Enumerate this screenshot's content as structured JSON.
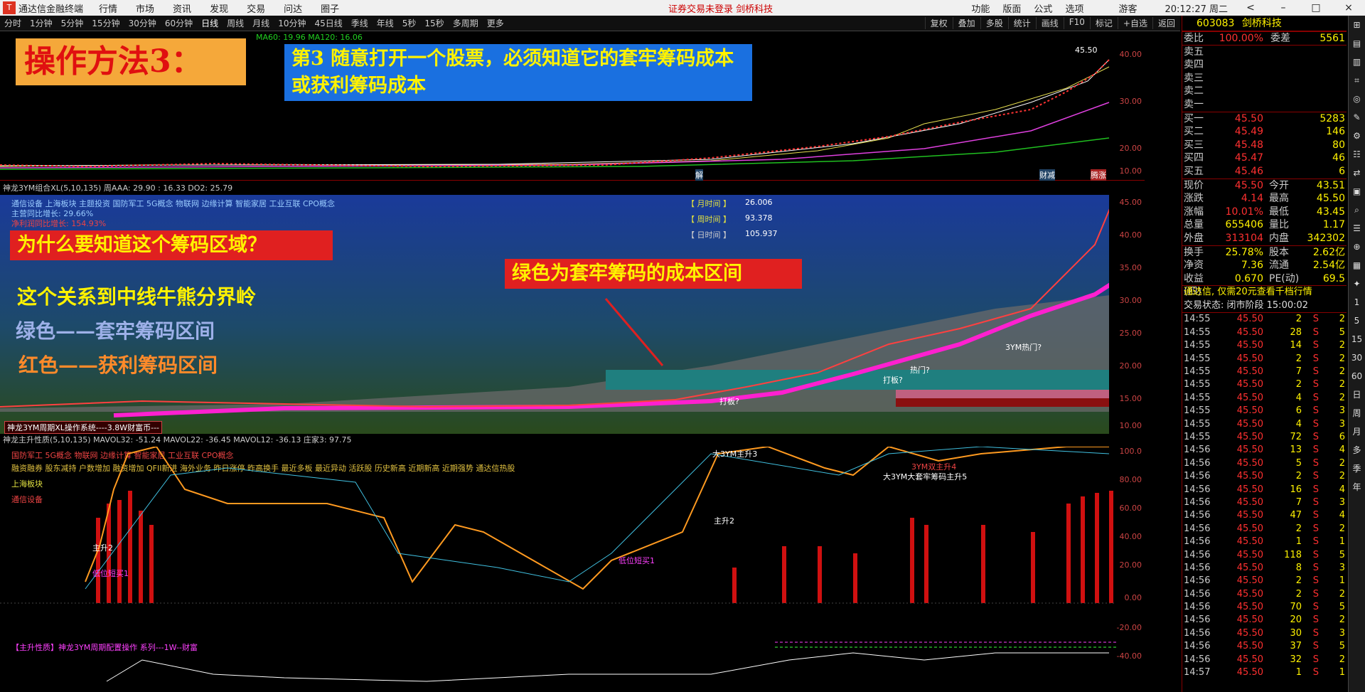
{
  "menubar": {
    "app_title": "通达信金融终端",
    "menus": [
      "行情",
      "市场",
      "资讯",
      "发现",
      "交易",
      "问达",
      "圈子"
    ],
    "center_notice": "证券交易未登录  剑桥科技",
    "right_items": [
      "功能",
      "版面",
      "公式",
      "选项"
    ],
    "user": "游客",
    "clock": "20:12:27 周二"
  },
  "periodbar": {
    "periods": [
      "分时",
      "1分钟",
      "5分钟",
      "15分钟",
      "30分钟",
      "60分钟",
      "日线",
      "周线",
      "月线",
      "10分钟",
      "45日线",
      "季线",
      "年线",
      "5秒",
      "15秒",
      "多周期",
      "更多"
    ],
    "active": "日线",
    "tools": [
      "复权",
      "叠加",
      "多股",
      "统计",
      "画线",
      "F10",
      "标记",
      "+自选",
      "返回"
    ]
  },
  "pane1": {
    "legend": "MA60: 19.96   MA120: 16.06",
    "label_price": "45.50",
    "marks": [
      "解",
      "财减",
      "腾涨"
    ],
    "axis": [
      "40.00",
      "30.00",
      "20.00",
      "10.00"
    ]
  },
  "pane2": {
    "header": "神龙3YM组合XL(5,10,135)  周AAA: 29.90 : 16.33  DO2: 25.79",
    "concepts": "通信设备 上海板块 主题投资 国防军工 5G概念 物联网 边缘计算 智能家居 工业互联 CPO概念",
    "growth1": "主营同比增长: 29.66%",
    "growth2": "净利润同比增长: 154.93%",
    "month_time_label": "【 月时间 】",
    "month_time": "26.006",
    "week_time_label": "【 周时间 】",
    "week_time": "93.378",
    "day_time_label": "【 日时间 】",
    "day_time": "105.937",
    "footer": "神龙3YM周期XL操作系统----3.8W财富币---",
    "signals": [
      "打板?",
      "热门?",
      "打板?",
      "3YM热门?"
    ],
    "axis": [
      "45.00",
      "40.00",
      "35.00",
      "30.00",
      "25.00",
      "20.00",
      "15.00",
      "10.00"
    ]
  },
  "pane3": {
    "header": "神龙主升性质(5,10,135)  MAVOL32: -51.24  MAVOL22: -36.45  MAVOL12: -36.13  庄家3: 97.75",
    "concepts": "国防军工 5G概念 物联网 边缘计算 智能家居 工业互联 CPO概念",
    "tags": "融资融券 股东减持 户数增加 融资增加 QFII新进 海外业务 昨日涨停 昨高换手 最近多板 最近异动 活跃股 历史新高 近期新高 近期强势 通达信热股",
    "board": "上海板块",
    "industry": "通信设备",
    "signals": [
      "主升2",
      "低位短买1",
      "大3YM主升3",
      "低位短买1",
      "主升2",
      "3YM双主升4",
      "大3YM大套牢筹码主升5"
    ],
    "footer": "【主升性质】神龙3YM周期配置操作 系列---1W--财富",
    "axis": [
      "100.0",
      "80.00",
      "60.00",
      "40.00",
      "20.00",
      "0.00",
      "-20.00",
      "-40.00"
    ]
  },
  "annotations": {
    "title": "操作方法3：",
    "step": "第3  随意打开一个股票，必须知道它的套牢筹码成本或获利筹码成本",
    "why": "为什么要知道这个筹码区域？",
    "green_note": "绿色为套牢筹码的成本区间",
    "line1": "这个关系到中线牛熊分界岭",
    "line2": "绿色——套牢筹码区间",
    "line3": "红色——获利筹码区间"
  },
  "quote": {
    "code": "603083",
    "name": "剑桥科技",
    "weibi_label": "委比",
    "weibi": "100.00%",
    "weicha_label": "委差",
    "weicha": "5561",
    "sell": [
      {
        "label": "卖五",
        "price": "",
        "vol": ""
      },
      {
        "label": "卖四",
        "price": "",
        "vol": ""
      },
      {
        "label": "卖三",
        "price": "",
        "vol": ""
      },
      {
        "label": "卖二",
        "price": "",
        "vol": ""
      },
      {
        "label": "卖一",
        "price": "",
        "vol": ""
      }
    ],
    "buy": [
      {
        "label": "买一",
        "price": "45.50",
        "vol": "5283"
      },
      {
        "label": "买二",
        "price": "45.49",
        "vol": "146"
      },
      {
        "label": "买三",
        "price": "45.48",
        "vol": "80"
      },
      {
        "label": "买四",
        "price": "45.47",
        "vol": "46"
      },
      {
        "label": "买五",
        "price": "45.46",
        "vol": "6"
      }
    ],
    "stats": [
      {
        "k1": "现价",
        "v1": "45.50",
        "k2": "今开",
        "v2": "43.51"
      },
      {
        "k1": "涨跌",
        "v1": "4.14",
        "k2": "最高",
        "v2": "45.50"
      },
      {
        "k1": "涨幅",
        "v1": "10.01%",
        "k2": "最低",
        "v2": "43.45"
      },
      {
        "k1": "总量",
        "v1": "655406",
        "k2": "量比",
        "v2": "1.17"
      },
      {
        "k1": "外盘",
        "v1": "313104",
        "k2": "内盘",
        "v2": "342302"
      }
    ],
    "stats2": [
      {
        "k1": "换手",
        "v1": "25.78%",
        "k2": "股本",
        "v2": "2.62亿"
      },
      {
        "k1": "净资",
        "v1": "7.36",
        "k2": "流通",
        "v2": "2.54亿"
      },
      {
        "k1": "收益(四)",
        "v1": "0.670",
        "k2": "PE(动)",
        "v2": "69.5"
      }
    ],
    "promo": "通达信, 仅需20元查看千档行情",
    "status": "交易状态: 闭市阶段 15:00:02",
    "ticks": [
      [
        "14:55",
        "45.50",
        "2",
        "S",
        "2"
      ],
      [
        "14:55",
        "45.50",
        "28",
        "S",
        "5"
      ],
      [
        "14:55",
        "45.50",
        "14",
        "S",
        "2"
      ],
      [
        "14:55",
        "45.50",
        "2",
        "S",
        "2"
      ],
      [
        "14:55",
        "45.50",
        "7",
        "S",
        "2"
      ],
      [
        "14:55",
        "45.50",
        "2",
        "S",
        "2"
      ],
      [
        "14:55",
        "45.50",
        "4",
        "S",
        "2"
      ],
      [
        "14:55",
        "45.50",
        "6",
        "S",
        "3"
      ],
      [
        "14:55",
        "45.50",
        "4",
        "S",
        "3"
      ],
      [
        "14:55",
        "45.50",
        "72",
        "S",
        "6"
      ],
      [
        "14:56",
        "45.50",
        "13",
        "S",
        "4"
      ],
      [
        "14:56",
        "45.50",
        "5",
        "S",
        "2"
      ],
      [
        "14:56",
        "45.50",
        "2",
        "S",
        "2"
      ],
      [
        "14:56",
        "45.50",
        "16",
        "S",
        "4"
      ],
      [
        "14:56",
        "45.50",
        "7",
        "S",
        "3"
      ],
      [
        "14:56",
        "45.50",
        "47",
        "S",
        "4"
      ],
      [
        "14:56",
        "45.50",
        "2",
        "S",
        "2"
      ],
      [
        "14:56",
        "45.50",
        "1",
        "S",
        "1"
      ],
      [
        "14:56",
        "45.50",
        "118",
        "S",
        "5"
      ],
      [
        "14:56",
        "45.50",
        "8",
        "S",
        "3"
      ],
      [
        "14:56",
        "45.50",
        "2",
        "S",
        "1"
      ],
      [
        "14:56",
        "45.50",
        "2",
        "S",
        "2"
      ],
      [
        "14:56",
        "45.50",
        "70",
        "S",
        "5"
      ],
      [
        "14:56",
        "45.50",
        "20",
        "S",
        "2"
      ],
      [
        "14:56",
        "45.50",
        "30",
        "S",
        "3"
      ],
      [
        "14:56",
        "45.50",
        "37",
        "S",
        "5"
      ],
      [
        "14:56",
        "45.50",
        "32",
        "S",
        "2"
      ],
      [
        "14:57",
        "45.50",
        "1",
        "S",
        "1"
      ]
    ]
  },
  "sidebar": {
    "period_items": [
      "1",
      "5",
      "15",
      "30",
      "60",
      "日",
      "周",
      "月",
      "多",
      "季",
      "年"
    ]
  }
}
